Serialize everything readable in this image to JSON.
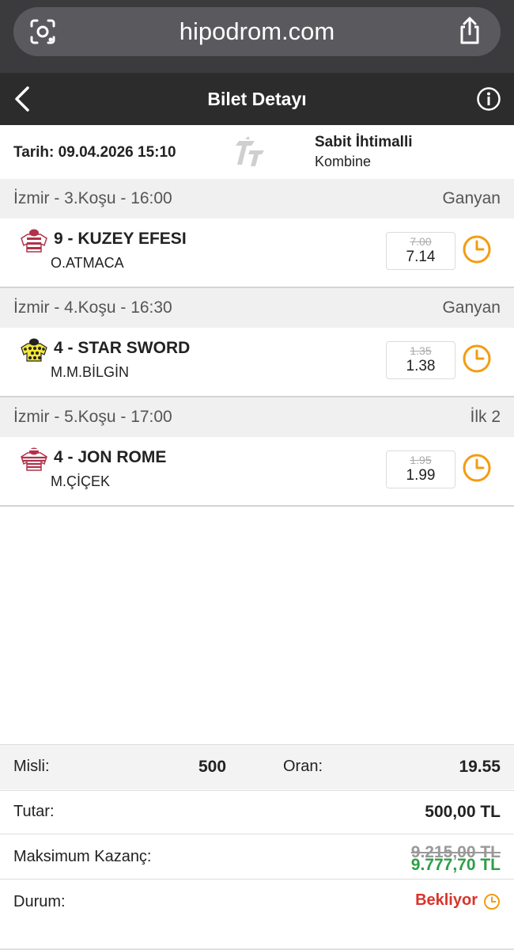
{
  "browser": {
    "url": "hipodrom.com",
    "icons": [
      "lens-search-icon",
      "share-icon"
    ]
  },
  "header": {
    "title": "Bilet Detayı",
    "icons": [
      "chevron-left-icon",
      "info-circle-icon"
    ]
  },
  "ticket": {
    "date_label": "Tarih:",
    "date_value": "09.04.2026 15:10",
    "bet_type": "Sabit İhtimalli",
    "bet_kind": "Kombine"
  },
  "races": [
    {
      "title": "İzmir - 3.Koşu - 16:00",
      "type": "Ganyan",
      "runner": "9 - KUZEY EFESI",
      "jockey": "O.ATMACA",
      "odds_old": "7.00",
      "odds_new": "7.14",
      "silk_colors": [
        "#b0324a",
        "#ffffff"
      ]
    },
    {
      "title": "İzmir - 4.Koşu - 16:30",
      "type": "Ganyan",
      "runner": "4 - STAR SWORD",
      "jockey": "M.M.BİLGİN",
      "odds_old": "1.35",
      "odds_new": "1.38",
      "silk_colors": [
        "#f2e63a",
        "#222222"
      ]
    },
    {
      "title": "İzmir - 5.Koşu - 17:00",
      "type": "İlk 2",
      "runner": "4 - JON ROME",
      "jockey": "M.ÇİÇEK",
      "odds_old": "1.95",
      "odds_new": "1.99",
      "silk_colors": [
        "#b0324a",
        "#ffffff"
      ]
    }
  ],
  "summary": {
    "misli_label": "Misli:",
    "misli_value": "500",
    "oran_label": "Oran:",
    "oran_value": "19.55",
    "tutar_label": "Tutar:",
    "tutar_value": "500,00 TL",
    "max_label": "Maksimum Kazanç:",
    "max_old": "9.215,00 TL",
    "max_new": "9.777,70 TL",
    "durum_label": "Durum:",
    "durum_value": "Bekliyor"
  },
  "colors": {
    "accent_orange": "#f39c12",
    "status_red": "#d9342b",
    "win_green": "#2e9e48",
    "header_dark": "#2c2c2c"
  }
}
